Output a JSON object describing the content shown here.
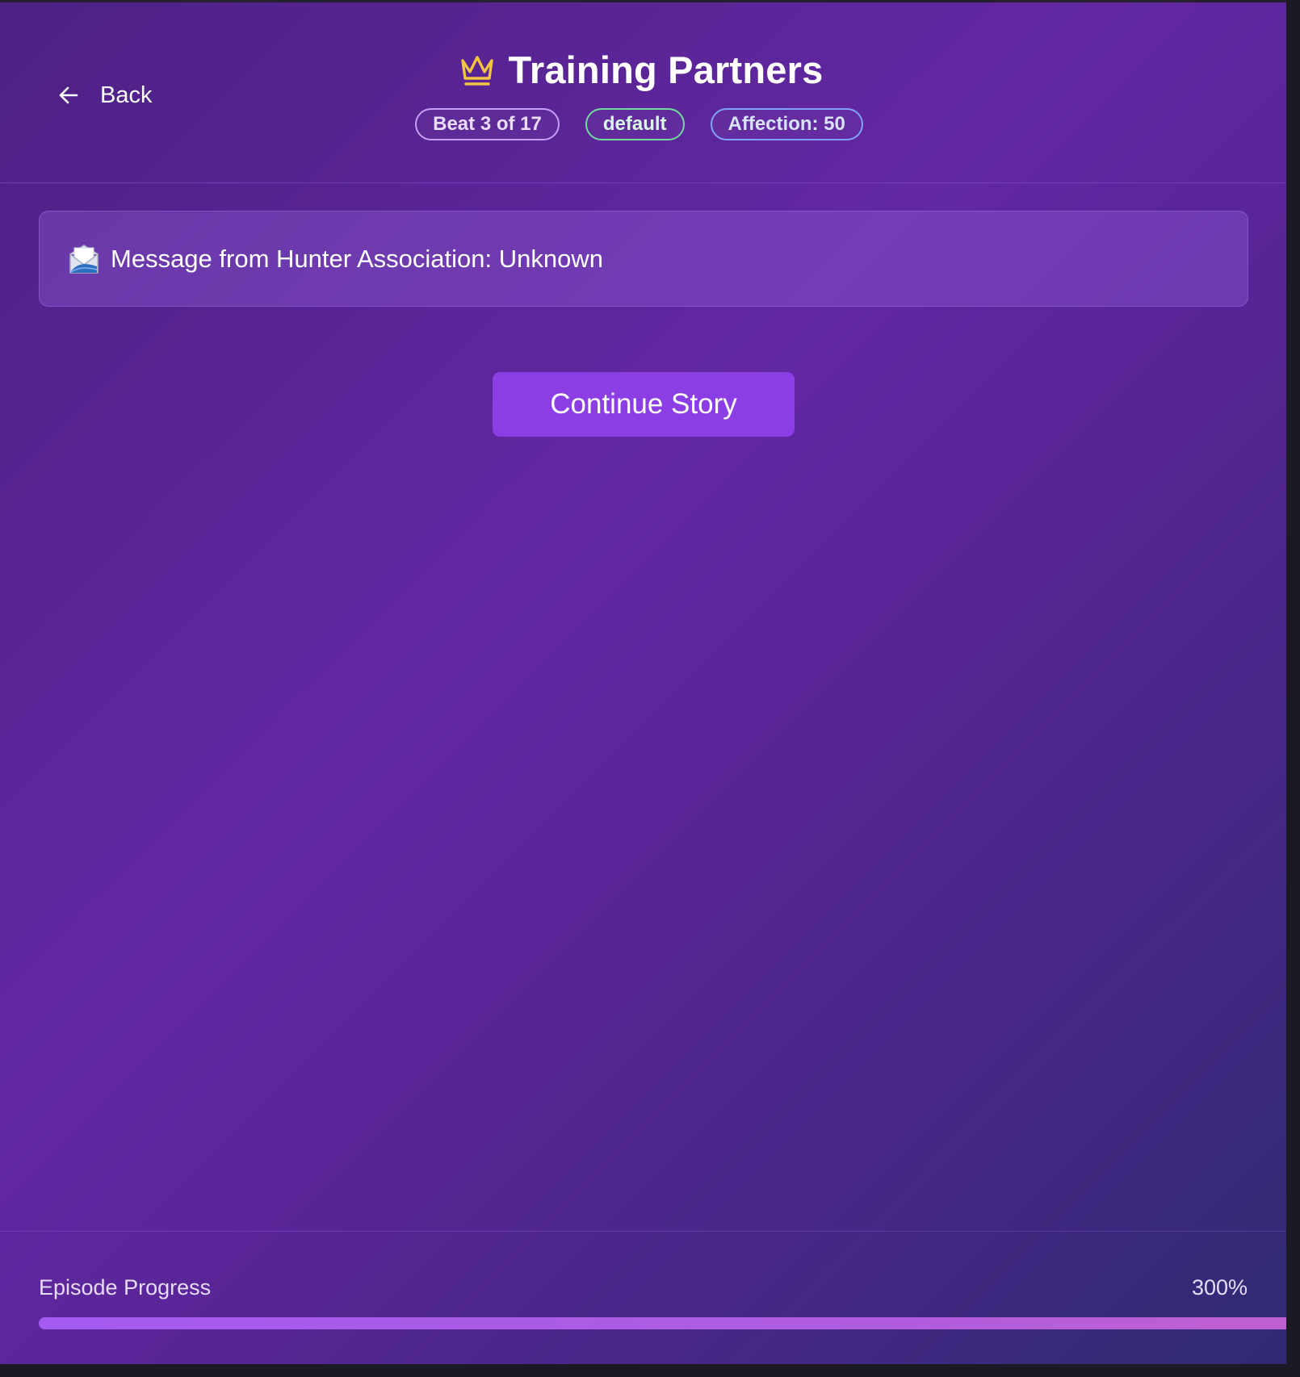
{
  "header": {
    "back_label": "Back",
    "title": "Training Partners",
    "title_icon": "crown-icon",
    "badges": {
      "beat": "Beat 3 of 17",
      "mood": "default",
      "affection": "Affection: 50"
    }
  },
  "message": {
    "icon": "envelope-icon",
    "text": "Message from Hunter Association: Unknown"
  },
  "actions": {
    "continue_label": "Continue Story"
  },
  "footer": {
    "progress_label": "Episode Progress",
    "progress_text": "300%",
    "progress_fraction": 3.0
  },
  "colors": {
    "accent": "#8b3ee4",
    "crown": "#f5c342",
    "badge_beat": "#c79ef8",
    "badge_mood": "#6fdb9d",
    "badge_affection": "#7fa3f7"
  }
}
